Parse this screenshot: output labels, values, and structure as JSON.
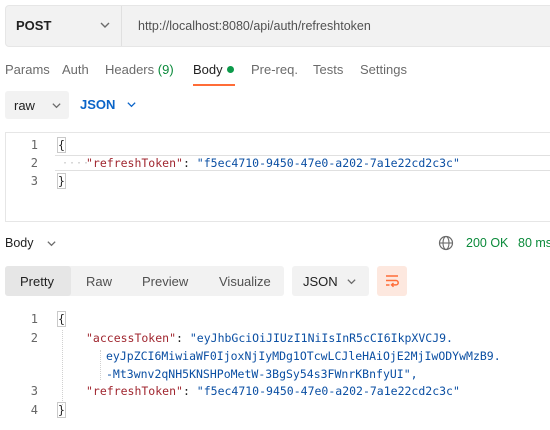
{
  "request": {
    "method": "POST",
    "url": "http://localhost:8080/api/auth/refreshtoken"
  },
  "request_tabs": {
    "params": "Params",
    "auth": "Auth",
    "headers": "Headers",
    "headers_count": "(9)",
    "body": "Body",
    "prereq": "Pre-req.",
    "tests": "Tests",
    "settings": "Settings"
  },
  "body_mode": {
    "type": "raw",
    "format": "JSON"
  },
  "request_body": {
    "line_numbers": [
      "1",
      "2",
      "3"
    ],
    "open_brace": "{",
    "key": "\"refreshToken\"",
    "colon": ": ",
    "value": "\"f5ec4710-9450-47e0-a202-7a1e22cd2c3c\"",
    "close_brace": "}"
  },
  "response": {
    "body_label": "Body",
    "status": "200 OK",
    "time": "80 ms",
    "view_tabs": {
      "pretty": "Pretty",
      "raw": "Raw",
      "preview": "Preview",
      "visualize": "Visualize"
    },
    "format": "JSON",
    "line_numbers": [
      "1",
      "2",
      "3",
      "4"
    ],
    "open_brace": "{",
    "access_key": "\"accessToken\"",
    "access_value_1": "\"eyJhbGciOiJIUzI1NiIsInR5cCI6IkpXVCJ9.",
    "access_value_2": "eyJpZCI6MiwiaWF0IjoxNjIyMDg1OTcwLCJleHAiOjE2MjIwODYwMzB9.",
    "access_value_3": "-Mt3wnv2qNH5KNSHPoMetW-3BgSy54s3FWnrKBnfyUI\",",
    "refresh_key": "\"refreshToken\"",
    "refresh_value": "\"f5ec4710-9450-47e0-a202-7a1e22cd2c3c\"",
    "colon": ": ",
    "close_brace": "}"
  },
  "colors": {
    "accent": "#ff6c37",
    "status_green": "#0a8a3a",
    "json_key": "#a0262f",
    "json_string": "#0b4fa3",
    "link_blue": "#0a64c8"
  },
  "icons": {
    "method_dropdown": "chevron-down-icon",
    "mode_dropdown": "chevron-down-icon",
    "format_dropdown": "chevron-down-icon",
    "network": "globe-icon",
    "wrap": "wrap-lines-icon"
  }
}
